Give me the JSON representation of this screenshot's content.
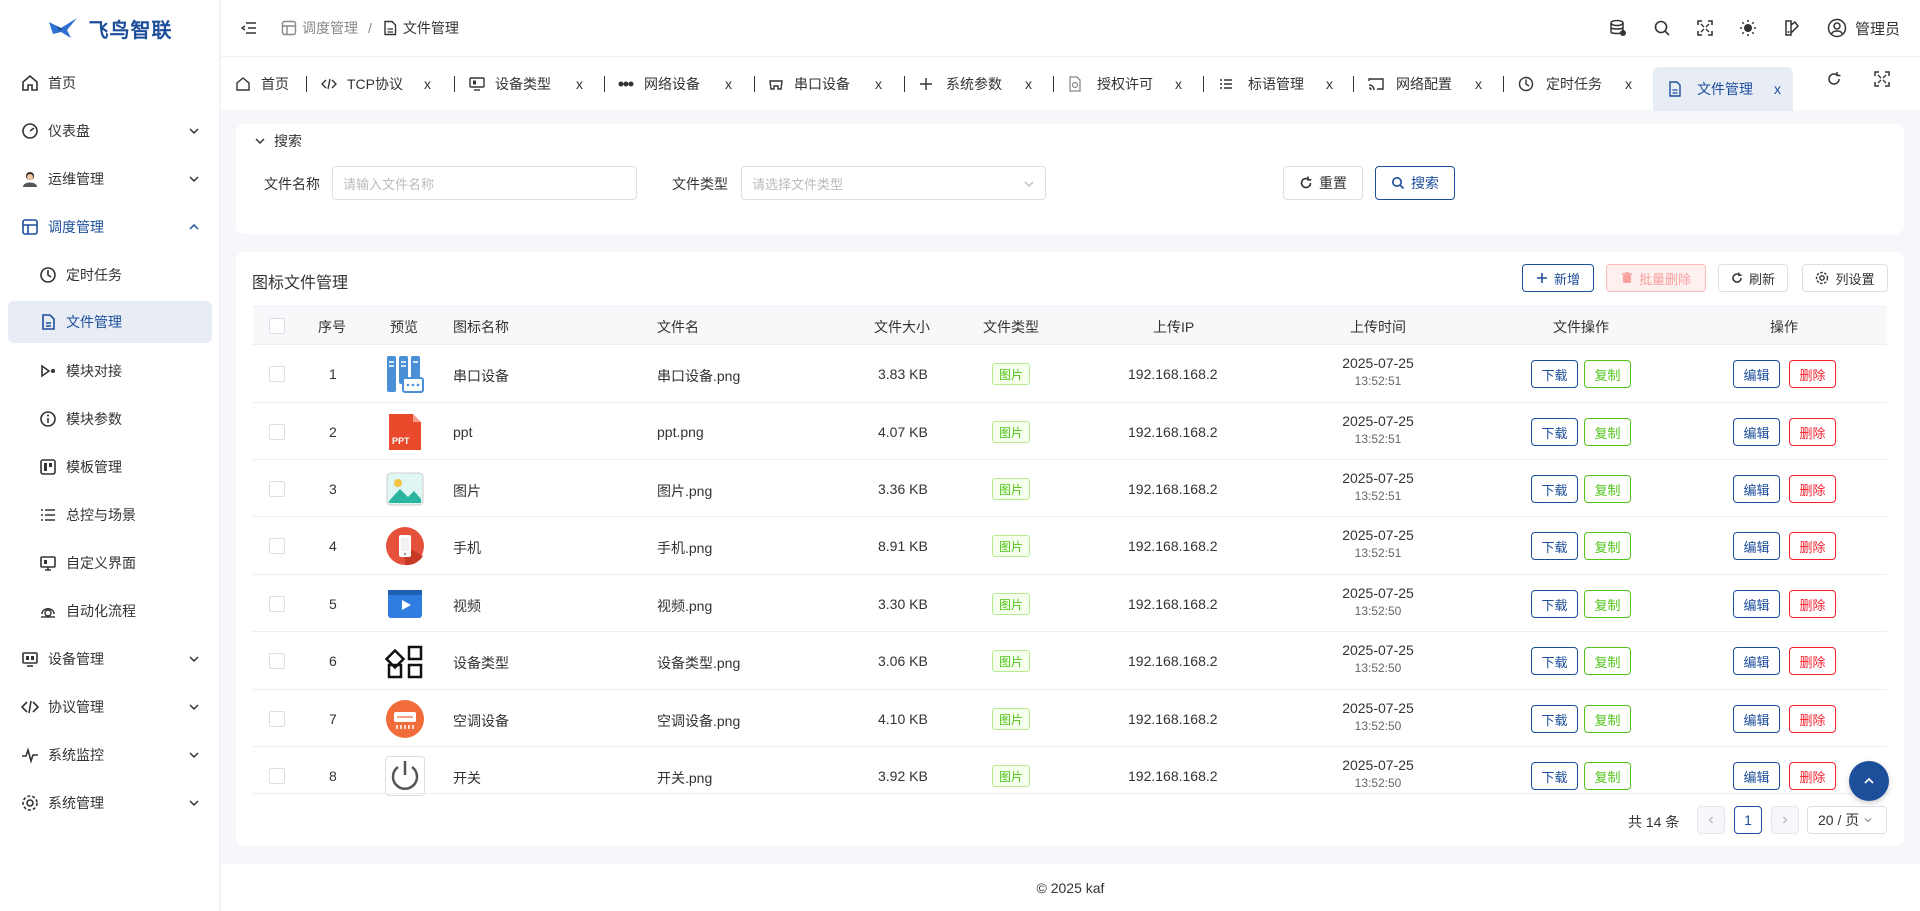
{
  "app": {
    "brand": "飞鸟智联"
  },
  "sidebar": {
    "items": [
      {
        "label": "首页",
        "icon": "home-icon"
      },
      {
        "label": "仪表盘",
        "icon": "dashboard-icon"
      },
      {
        "label": "运维管理",
        "icon": "user-avatar-icon"
      },
      {
        "label": "调度管理",
        "icon": "schedule-icon"
      },
      {
        "label": "设备管理",
        "icon": "device-icon"
      },
      {
        "label": "协议管理",
        "icon": "protocol-icon"
      },
      {
        "label": "系统监控",
        "icon": "monitor-icon"
      },
      {
        "label": "系统管理",
        "icon": "settings-icon"
      }
    ],
    "sub_items": [
      {
        "label": "定时任务",
        "icon": "clock-icon"
      },
      {
        "label": "文件管理",
        "icon": "file-icon"
      },
      {
        "label": "模块对接",
        "icon": "module-link-icon"
      },
      {
        "label": "模块参数",
        "icon": "info-icon"
      },
      {
        "label": "模板管理",
        "icon": "template-icon"
      },
      {
        "label": "总控与场景",
        "icon": "list-icon"
      },
      {
        "label": "自定义界面",
        "icon": "screen-icon"
      },
      {
        "label": "自动化流程",
        "icon": "flow-icon"
      }
    ]
  },
  "header": {
    "breadcrumb": [
      "调度管理",
      "/",
      "文件管理"
    ],
    "user": "管理员"
  },
  "tabs": [
    {
      "label": "首页"
    },
    {
      "label": "TCP协议"
    },
    {
      "label": "设备类型"
    },
    {
      "label": "网络设备"
    },
    {
      "label": "串口设备"
    },
    {
      "label": "系统参数"
    },
    {
      "label": "授权许可"
    },
    {
      "label": "标语管理"
    },
    {
      "label": "网络配置"
    },
    {
      "label": "定时任务"
    },
    {
      "label": "文件管理"
    }
  ],
  "tab_close": "x",
  "search": {
    "toggle_label": "搜索",
    "name_label": "文件名称",
    "name_placeholder": "请输入文件名称",
    "type_label": "文件类型",
    "type_placeholder": "请选择文件类型",
    "reset_label": "重置",
    "search_label": "搜索"
  },
  "table_section": {
    "title": "图标文件管理",
    "add_label": "新增",
    "batch_delete_label": "批量删除",
    "refresh_label": "刷新",
    "columns_label": "列设置"
  },
  "table": {
    "headers": [
      "序号",
      "预览",
      "图标名称",
      "文件名",
      "文件大小",
      "文件类型",
      "上传IP",
      "上传时间",
      "文件操作",
      "操作"
    ],
    "rows": [
      {
        "no": "1",
        "name": "串口设备",
        "file": "串口设备.png",
        "size": "3.83 KB",
        "type": "图片",
        "ip": "192.168.168.2",
        "date": "2025-07-25",
        "time": "13:52:51"
      },
      {
        "no": "2",
        "name": "ppt",
        "file": "ppt.png",
        "size": "4.07 KB",
        "type": "图片",
        "ip": "192.168.168.2",
        "date": "2025-07-25",
        "time": "13:52:51"
      },
      {
        "no": "3",
        "name": "图片",
        "file": "图片.png",
        "size": "3.36 KB",
        "type": "图片",
        "ip": "192.168.168.2",
        "date": "2025-07-25",
        "time": "13:52:51"
      },
      {
        "no": "4",
        "name": "手机",
        "file": "手机.png",
        "size": "8.91 KB",
        "type": "图片",
        "ip": "192.168.168.2",
        "date": "2025-07-25",
        "time": "13:52:51"
      },
      {
        "no": "5",
        "name": "视频",
        "file": "视频.png",
        "size": "3.30 KB",
        "type": "图片",
        "ip": "192.168.168.2",
        "date": "2025-07-25",
        "time": "13:52:50"
      },
      {
        "no": "6",
        "name": "设备类型",
        "file": "设备类型.png",
        "size": "3.06 KB",
        "type": "图片",
        "ip": "192.168.168.2",
        "date": "2025-07-25",
        "time": "13:52:50"
      },
      {
        "no": "7",
        "name": "空调设备",
        "file": "空调设备.png",
        "size": "4.10 KB",
        "type": "图片",
        "ip": "192.168.168.2",
        "date": "2025-07-25",
        "time": "13:52:50"
      },
      {
        "no": "8",
        "name": "开关",
        "file": "开关.png",
        "size": "3.92 KB",
        "type": "图片",
        "ip": "192.168.168.2",
        "date": "2025-07-25",
        "time": "13:52:50"
      }
    ],
    "row_actions": {
      "download": "下载",
      "copy": "复制",
      "edit": "编辑",
      "delete": "删除"
    },
    "preview_icons": [
      "serial-device-icon",
      "ppt-icon",
      "image-icon",
      "phone-icon",
      "video-icon",
      "device-type-icon",
      "air-conditioner-icon",
      "power-switch-icon"
    ],
    "ppt_badge": "PPT"
  },
  "pagination": {
    "total": "共 14 条",
    "current": "1",
    "page_size": "20 / 页"
  },
  "footer": {
    "copyright": "© 2025 kaf"
  },
  "colors": {
    "primary": "#1d4e9a",
    "success": "#52c41a",
    "danger": "#f5222d"
  }
}
